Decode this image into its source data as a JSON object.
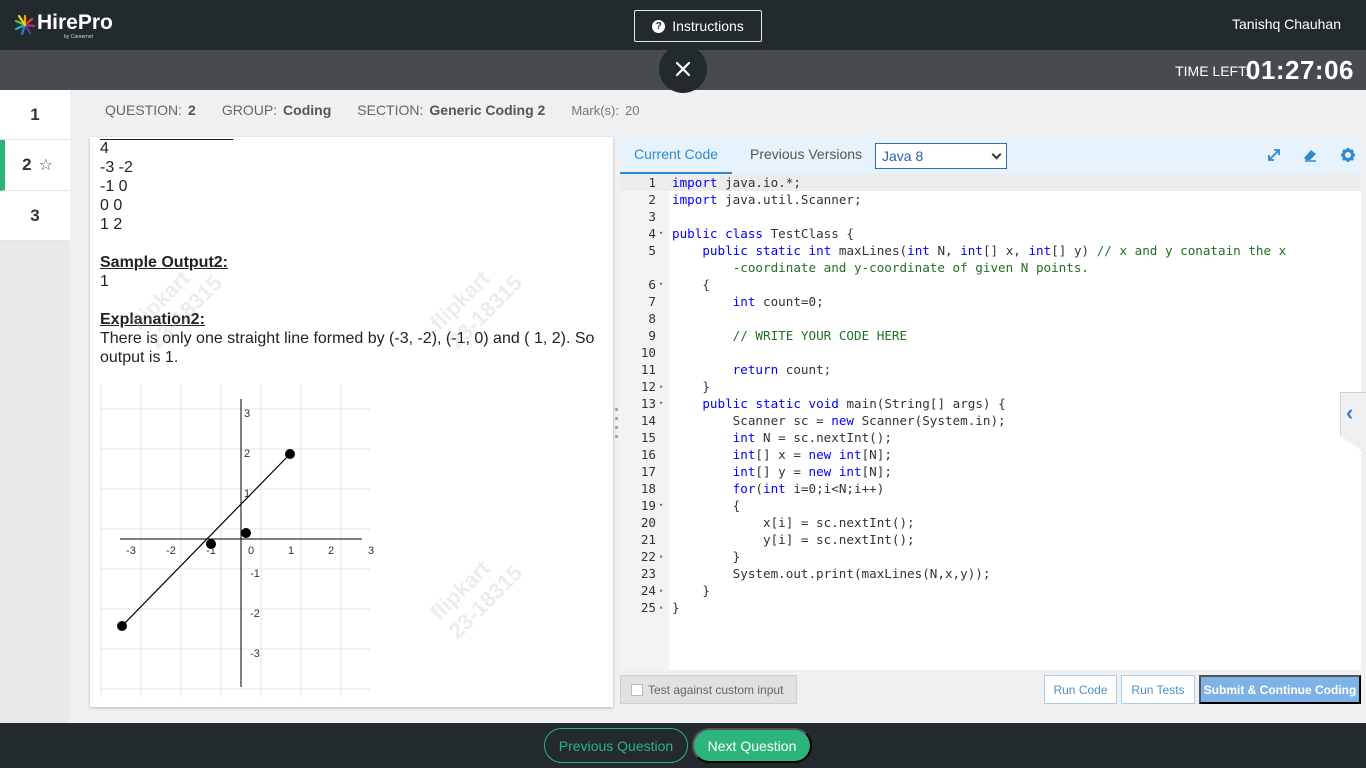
{
  "header": {
    "logo_text": "HirePro",
    "logo_subtext": "by Careernet",
    "instructions_label": "Instructions",
    "username": "Tanishq Chauhan",
    "time_left_label": "TIME LEFT:",
    "time_left_value": "01:27:06",
    "close_icon": "close-icon"
  },
  "question_nav": {
    "items": [
      {
        "label": "1"
      },
      {
        "label": "2",
        "active": true
      },
      {
        "label": "3"
      }
    ]
  },
  "meta": {
    "question_label": "QUESTION:",
    "question_value": "2",
    "group_label": "GROUP:",
    "group_value": "Coding",
    "section_label": "SECTION:",
    "section_value": "Generic Coding 2",
    "marks_label": "Mark(s):",
    "marks_value": "20"
  },
  "problem": {
    "input_lines": [
      "4",
      "-3 -2",
      "-1 0",
      "0 0",
      "1 2"
    ],
    "sample_output_heading": "Sample Output2:",
    "sample_output_value": "1",
    "explanation_heading": "Explanation2:",
    "explanation_line1": "There is only one straight line formed by (-3, -2), (-1, 0) and ( 1, 2). So",
    "explanation_line2": "output is 1.",
    "watermark_line1": "flipkart",
    "watermark_line2": "23-18315"
  },
  "graph_data": {
    "x_ticks": [
      "-3",
      "-2",
      "-1",
      "0",
      "1",
      "2",
      "3"
    ],
    "y_ticks_pos": [
      "3",
      "2",
      "1"
    ],
    "y_ticks_neg": [
      "-1",
      "-2",
      "-3"
    ],
    "points": [
      [
        -3,
        -2
      ],
      [
        -1,
        0
      ],
      [
        0,
        0
      ],
      [
        1,
        2
      ]
    ],
    "line": [
      [
        -3,
        -2
      ],
      [
        1,
        2
      ]
    ]
  },
  "editor": {
    "tab_current": "Current Code",
    "tab_previous": "Previous Versions",
    "language": "Java 8",
    "icons": [
      "expand-icon",
      "eraser-icon",
      "settings-gear-icon"
    ],
    "custom_input_label": "Test against custom input",
    "run_code_label": "Run Code",
    "run_tests_label": "Run Tests",
    "submit_label": "Submit & Continue Coding"
  },
  "code_lines": [
    {
      "n": "1",
      "fold": "",
      "text": "import java.io.*;"
    },
    {
      "n": "2",
      "fold": "",
      "text": "import java.util.Scanner;"
    },
    {
      "n": "3",
      "fold": "",
      "text": ""
    },
    {
      "n": "4",
      "fold": "▾",
      "text": "public class TestClass {"
    },
    {
      "n": "5",
      "fold": "",
      "text": "    public static int maxLines(int N, int[] x, int[] y) // x and y conatain the x"
    },
    {
      "n": "",
      "fold": "",
      "text": "        -coordinate and y-coordinate of given N points."
    },
    {
      "n": "6",
      "fold": "▾",
      "text": "    {"
    },
    {
      "n": "7",
      "fold": "",
      "text": "        int count=0;"
    },
    {
      "n": "8",
      "fold": "",
      "text": ""
    },
    {
      "n": "9",
      "fold": "",
      "text": "        // WRITE YOUR CODE HERE"
    },
    {
      "n": "10",
      "fold": "",
      "text": ""
    },
    {
      "n": "11",
      "fold": "",
      "text": "        return count;"
    },
    {
      "n": "12",
      "fold": "▴",
      "text": "    }"
    },
    {
      "n": "13",
      "fold": "▾",
      "text": "    public static void main(String[] args) {"
    },
    {
      "n": "14",
      "fold": "",
      "text": "        Scanner sc = new Scanner(System.in);"
    },
    {
      "n": "15",
      "fold": "",
      "text": "        int N = sc.nextInt();"
    },
    {
      "n": "16",
      "fold": "",
      "text": "        int[] x = new int[N];"
    },
    {
      "n": "17",
      "fold": "",
      "text": "        int[] y = new int[N];"
    },
    {
      "n": "18",
      "fold": "",
      "text": "        for(int i=0;i<N;i++)"
    },
    {
      "n": "19",
      "fold": "▾",
      "text": "        {"
    },
    {
      "n": "20",
      "fold": "",
      "text": "            x[i] = sc.nextInt();"
    },
    {
      "n": "21",
      "fold": "",
      "text": "            y[i] = sc.nextInt();"
    },
    {
      "n": "22",
      "fold": "▴",
      "text": "        }"
    },
    {
      "n": "23",
      "fold": "",
      "text": "        System.out.print(maxLines(N,x,y));"
    },
    {
      "n": "24",
      "fold": "▴",
      "text": "    }"
    },
    {
      "n": "25",
      "fold": "▴",
      "text": "}"
    }
  ],
  "footer": {
    "previous_label": "Previous Question",
    "next_label": "Next Question"
  }
}
